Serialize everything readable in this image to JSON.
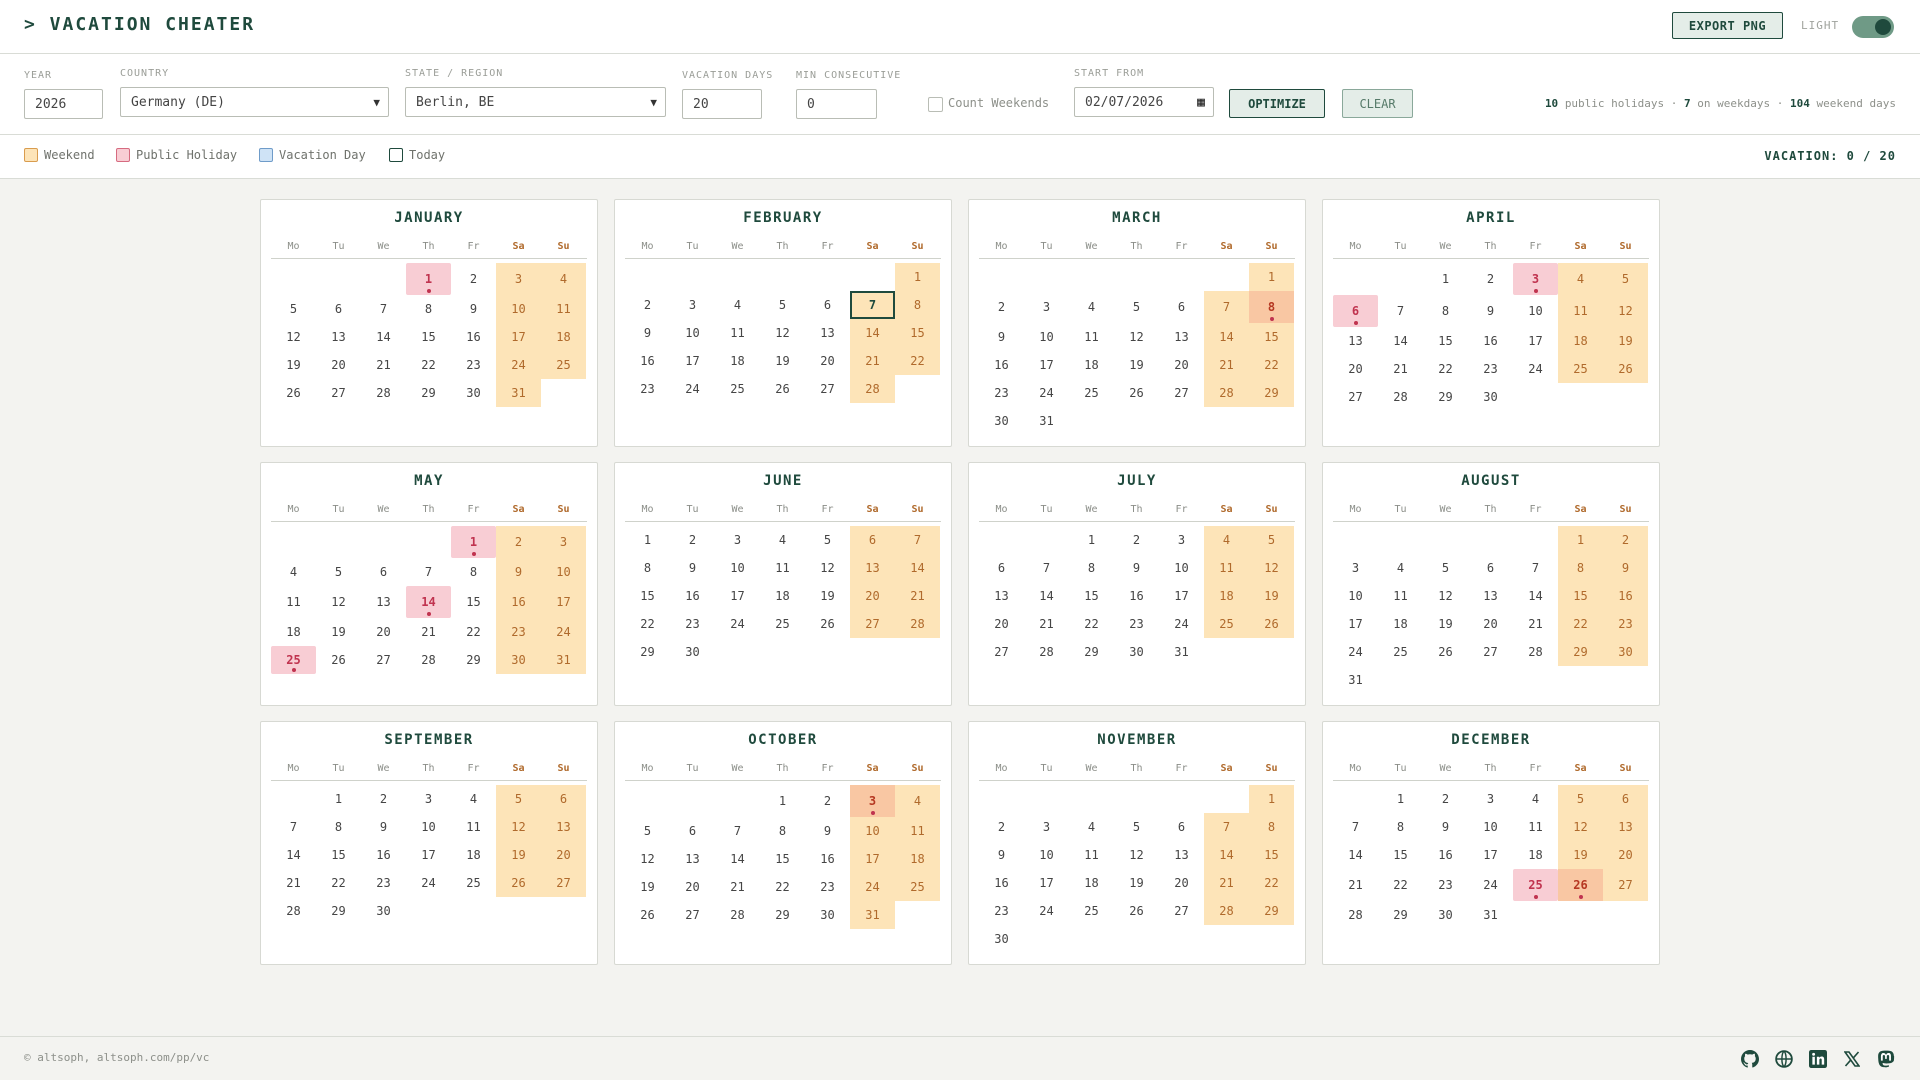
{
  "app": {
    "title": "> VACATION CHEATER",
    "export_label": "EXPORT PNG",
    "theme_label": "LIGHT",
    "theme_on": true
  },
  "controls": {
    "year": {
      "label": "YEAR",
      "value": "2026"
    },
    "country": {
      "label": "COUNTRY",
      "value": "Germany (DE)"
    },
    "state": {
      "label": "STATE / REGION",
      "value": "Berlin, BE"
    },
    "vacation_days": {
      "label": "VACATION DAYS",
      "value": "20"
    },
    "min_consecutive": {
      "label": "MIN CONSECUTIVE",
      "value": "0"
    },
    "count_weekends": {
      "label": "Count Weekends",
      "checked": false
    },
    "start_from": {
      "label": "START FROM",
      "value": "02/07/2026"
    },
    "optimize_label": "OPTIMIZE",
    "clear_label": "CLEAR"
  },
  "stats": {
    "holidays": "10",
    "holidays_text": "public holidays",
    "sep": "·",
    "weekdays": "7",
    "weekdays_text": "on weekdays",
    "weekend_days": "104",
    "weekend_text": "weekend days"
  },
  "legend": {
    "weekend": "Weekend",
    "holiday": "Public Holiday",
    "vacation": "Vacation Day",
    "today": "Today",
    "vacation_count": "VACATION: 0 / 20",
    "colors": {
      "weekend": "#fde4b8",
      "holiday": "#f8cdd4",
      "vacation": "#cfe3f6",
      "accent": "#1f4a3d"
    }
  },
  "weekday_headers": [
    "Mo",
    "Tu",
    "We",
    "Th",
    "Fr",
    "Sa",
    "Su"
  ],
  "months": [
    {
      "name": "JANUARY",
      "offset": 3,
      "days": 31,
      "holidays": [
        1
      ],
      "today": null
    },
    {
      "name": "FEBRUARY",
      "offset": 6,
      "days": 28,
      "holidays": [],
      "today": 7
    },
    {
      "name": "MARCH",
      "offset": 6,
      "days": 31,
      "holidays": [
        8
      ],
      "today": null
    },
    {
      "name": "APRIL",
      "offset": 2,
      "days": 30,
      "holidays": [
        3,
        6
      ],
      "today": null
    },
    {
      "name": "MAY",
      "offset": 4,
      "days": 31,
      "holidays": [
        1,
        14,
        25
      ],
      "today": null
    },
    {
      "name": "JUNE",
      "offset": 0,
      "days": 30,
      "holidays": [],
      "today": null
    },
    {
      "name": "JULY",
      "offset": 2,
      "days": 31,
      "holidays": [],
      "today": null
    },
    {
      "name": "AUGUST",
      "offset": 5,
      "days": 31,
      "holidays": [],
      "today": null
    },
    {
      "name": "SEPTEMBER",
      "offset": 1,
      "days": 30,
      "holidays": [],
      "today": null
    },
    {
      "name": "OCTOBER",
      "offset": 3,
      "days": 31,
      "holidays": [
        3
      ],
      "today": null
    },
    {
      "name": "NOVEMBER",
      "offset": 6,
      "days": 30,
      "holidays": [],
      "today": null
    },
    {
      "name": "DECEMBER",
      "offset": 1,
      "days": 31,
      "holidays": [
        25,
        26
      ],
      "today": null
    }
  ],
  "footer": {
    "copyright": "© altsoph, altsoph.com/pp/vc",
    "icons": [
      "github-icon",
      "globe-icon",
      "linkedin-icon",
      "x-icon",
      "mastodon-icon"
    ]
  }
}
